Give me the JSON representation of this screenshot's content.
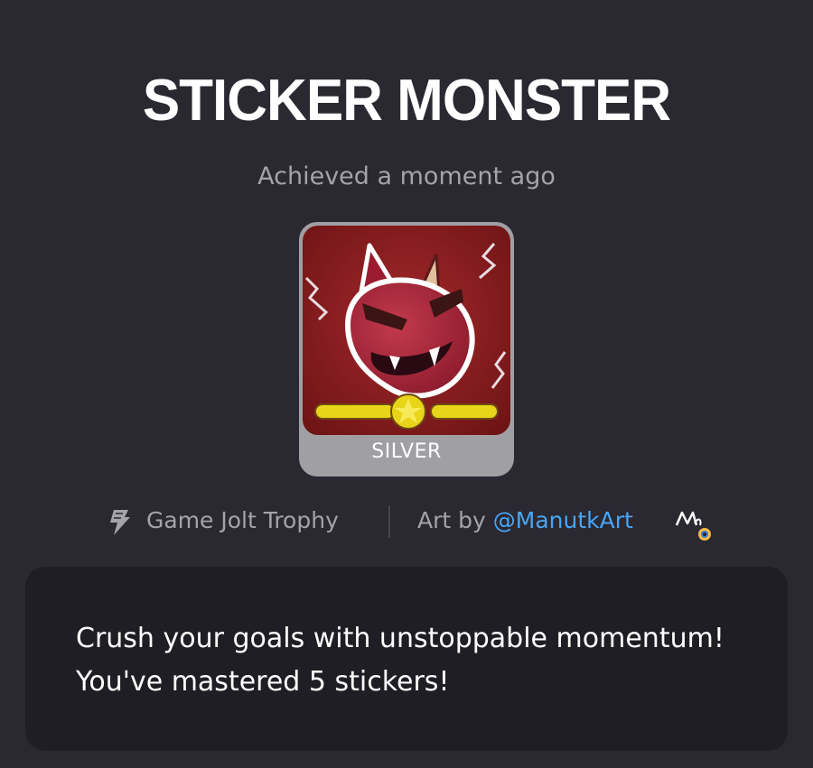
{
  "trophy": {
    "title": "STICKER MONSTER",
    "achieved_text": "Achieved a moment ago",
    "tier": "SILVER",
    "type_label": "Game Jolt Trophy",
    "art_by_prefix": "Art by ",
    "artist_handle": "@ManutkArt",
    "description": "Crush your goals with unstoppable momentum! You've mastered 5 stickers!",
    "icons": {
      "type_icon": "game-jolt-bolt-icon",
      "artist_badge": "artist-avatar-icon"
    },
    "colors": {
      "background": "#2a2830",
      "panel": "#1f1e24",
      "link": "#49a5f5",
      "tier_frame": "#a09fa3",
      "art_red": "#8e1c1e"
    }
  }
}
